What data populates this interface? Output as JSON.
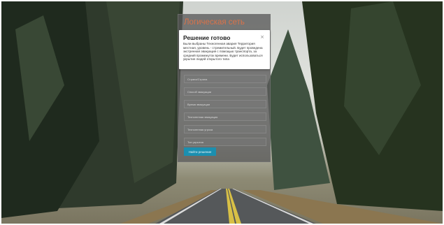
{
  "panel": {
    "title": "Логическая сеть",
    "fields": [
      {
        "value": "Страна/Страна"
      },
      {
        "value": "Способ эвакуации"
      },
      {
        "value": "Время эвакуации"
      },
      {
        "value": "Техногенная эвакуация"
      },
      {
        "value": "Техногенная угроза"
      },
      {
        "value": "Тип укрытия"
      }
    ],
    "submit_label": "Найти решение"
  },
  "modal": {
    "title": "Решение готово",
    "close_symbol": "×",
    "message": "Были выбраны Техногенная авария Территория местная, уровень - стремительный. Будет проведена экстренная эвакуация с помощью транспорта, за средний промежуток времени. Будет использоваться укрытие людей открытого типа"
  },
  "colors": {
    "accent_title": "#d9734a",
    "button": "#1b8fb0"
  }
}
